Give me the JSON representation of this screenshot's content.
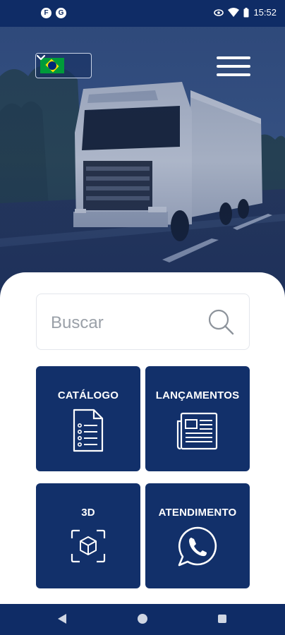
{
  "status_bar": {
    "left_icons": [
      "F",
      "G"
    ],
    "time": "15:52",
    "icons": [
      "eye-icon",
      "wifi-icon",
      "battery-icon"
    ]
  },
  "header": {
    "language": "Português (Brasil)",
    "flag": "brazil-flag-icon",
    "menu_icon": "hamburger-menu-icon"
  },
  "search": {
    "placeholder": "Buscar"
  },
  "tiles": [
    {
      "label": "CATÁLOGO",
      "icon": "document-list-icon"
    },
    {
      "label": "LANÇAMENTOS",
      "icon": "newspaper-icon"
    },
    {
      "label": "3D",
      "icon": "cube-3d-icon"
    },
    {
      "label": "ATENDIMENTO",
      "icon": "whatsapp-icon"
    }
  ],
  "colors": {
    "primary": "#12306a",
    "status_bar": "#0f2c66",
    "background": "#ffffff"
  }
}
